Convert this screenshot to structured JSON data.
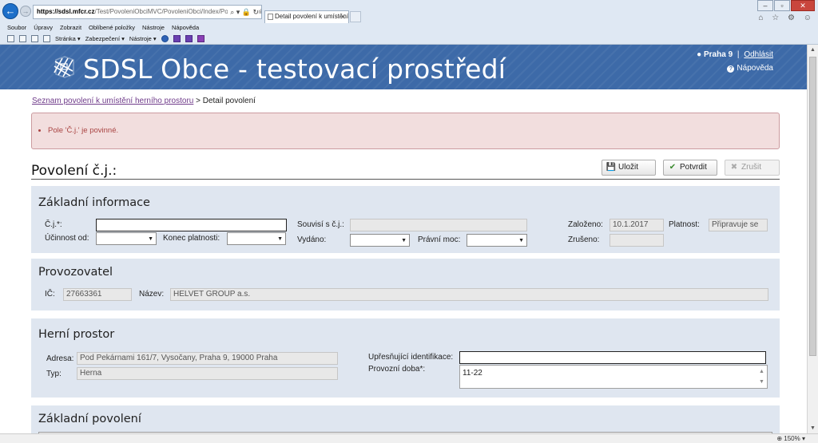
{
  "browser": {
    "address_host": "https://sdsl.mfcr.cz",
    "address_path": "/Test/PovoleniObciMVC/PovoleniObci/Index/PovoleniMistniDeta",
    "address_icons": "⌕ ▾ 🔒 ↻",
    "tab_title": "Detail povolení k umístění ...",
    "tab_close": "✕",
    "menu": [
      "Soubor",
      "Úpravy",
      "Zobrazit",
      "Oblíbené položky",
      "Nástroje",
      "Nápověda"
    ],
    "toolbar": [
      "Stránka ▾",
      "Zabezpečení ▾",
      "Nástroje ▾"
    ],
    "window_controls": [
      "–",
      "▫",
      "✕"
    ],
    "right_icons": "⌂ ☆ ⚙ ☺",
    "zoom": "150%"
  },
  "header": {
    "site_title": "SDSL Obce - testovací prostředí",
    "user_name": "Praha 9",
    "separator": "|",
    "logout": "Odhlásit",
    "help": "Nápověda",
    "help_icon": "?"
  },
  "breadcrumb": {
    "link": "Seznam povolení k umístění herního prostoru",
    "separator": ">",
    "current": "Detail povolení"
  },
  "validation": {
    "errors": [
      "Pole 'Č.j.' je povinné."
    ]
  },
  "page": {
    "title": "Povolení č.j.:",
    "buttons": {
      "save": "Uložit",
      "confirm": "Potvrdit",
      "cancel": "Zrušit",
      "save_icon": "💾",
      "confirm_icon": "✔",
      "cancel_icon": "✖"
    }
  },
  "basic_info": {
    "title": "Základní informace",
    "cj_label": "Č.j.*:",
    "cj_value": "",
    "related_label": "Souvisí s č.j.:",
    "related_value": "",
    "effective_label": "Účinnost od:",
    "effective_value": "",
    "end_label": "Konec platnosti:",
    "end_value": "",
    "issued_label": "Vydáno:",
    "issued_value": "",
    "legal_label": "Právní moc:",
    "legal_value": "",
    "created_label": "Založeno:",
    "created_value": "10.1.2017",
    "validity_label": "Platnost:",
    "validity_value": "Připravuje se",
    "cancelled_label": "Zrušeno:",
    "cancelled_value": ""
  },
  "operator": {
    "title": "Provozovatel",
    "ic_label": "IČ:",
    "ic_value": "27663361",
    "name_label": "Název:",
    "name_value": "HELVET GROUP a.s."
  },
  "premises": {
    "title": "Herní prostor",
    "address_label": "Adresa:",
    "address_value": "Pod Pekárnami 161/7, Vysočany, Praha 9, 19000 Praha",
    "type_label": "Typ:",
    "type_value": "Herna",
    "spec_label": "Upřesňující identifikace:",
    "spec_value": "",
    "hours_label": "Provozní doba*:",
    "hours_value": "11-22"
  },
  "base_permit": {
    "title": "Základní povolení"
  }
}
